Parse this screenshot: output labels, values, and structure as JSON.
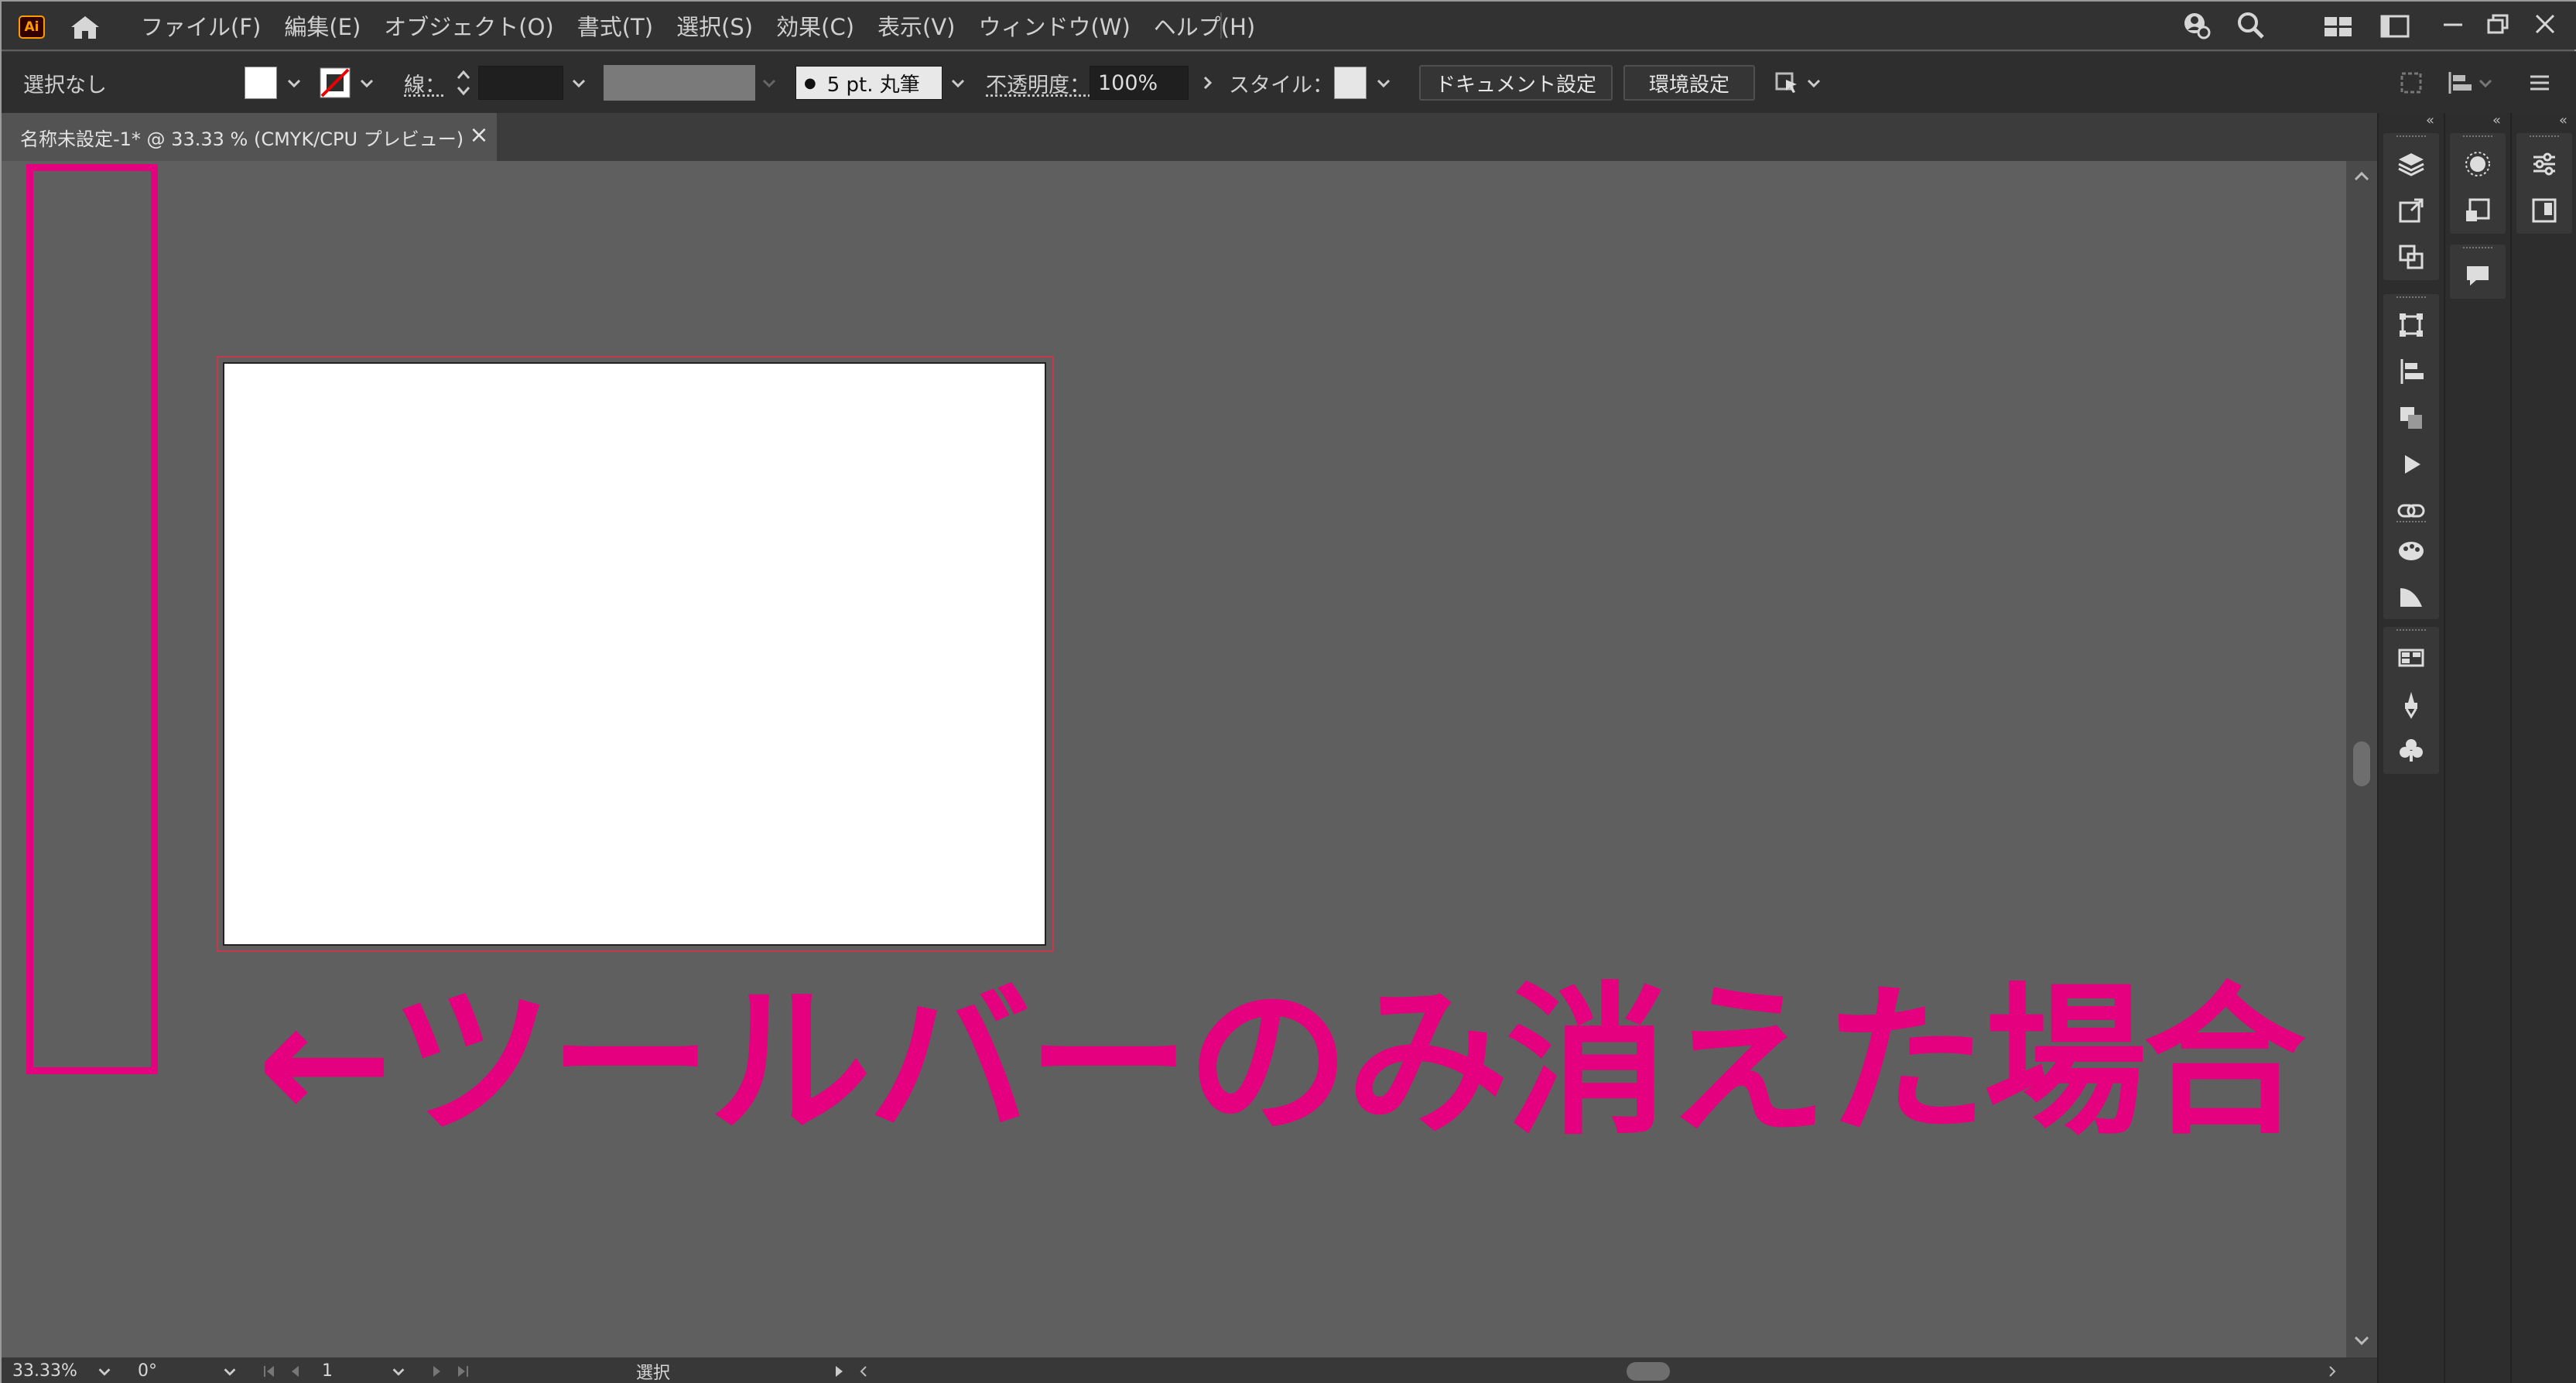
{
  "app": {
    "logo_text": "Ai"
  },
  "menu": {
    "items": [
      "ファイル(F)",
      "編集(E)",
      "オブジェクト(O)",
      "書式(T)",
      "選択(S)",
      "効果(C)",
      "表示(V)",
      "ウィンドウ(W)",
      "ヘルプ(H)"
    ]
  },
  "control_bar": {
    "selection_status": "選択なし",
    "stroke_label": "線：",
    "brush_dot": "●",
    "brush_value": "5 pt. 丸筆",
    "opacity_label": "不透明度：",
    "opacity_value": "100%",
    "style_label": "スタイル：",
    "document_setup_label": "ドキュメント設定",
    "preferences_label": "環境設定"
  },
  "document_tab": {
    "title": "名称未設定-1* @ 33.33 % (CMYK/CPU プレビュー)",
    "close_glyph": "×"
  },
  "annotation": {
    "text": "←ツールバーのみ消えた場合",
    "color": "#e4007f"
  },
  "status_bar": {
    "zoom": "33.33%",
    "rotation": "0°",
    "artboard_number": "1",
    "tool_status": "選択"
  },
  "colors": {
    "accent_highlight": "#e4007f",
    "ui_dark": "#323232",
    "canvas": "#5f5f5f"
  }
}
